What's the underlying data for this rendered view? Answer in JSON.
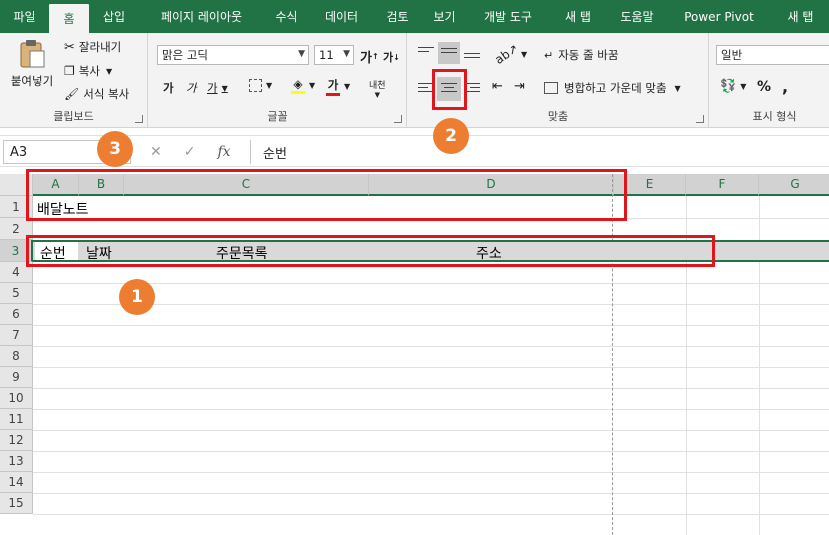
{
  "tabs": [
    {
      "label": "파일",
      "active": false
    },
    {
      "label": "홈",
      "active": true
    },
    {
      "label": "삽입",
      "active": false
    },
    {
      "label": "페이지 레이아웃",
      "active": false
    },
    {
      "label": "수식",
      "active": false
    },
    {
      "label": "데이터",
      "active": false
    },
    {
      "label": "검토",
      "active": false
    },
    {
      "label": "보기",
      "active": false
    },
    {
      "label": "개발 도구",
      "active": false
    },
    {
      "label": "새 탭",
      "active": false
    },
    {
      "label": "도움말",
      "active": false
    },
    {
      "label": "Power Pivot",
      "active": false
    },
    {
      "label": "새 탭",
      "active": false
    }
  ],
  "ribbon": {
    "clipboard": {
      "label": "클립보드",
      "paste_label": "붙여넣기",
      "cut_label": "잘라내기",
      "copy_label": "복사",
      "format_painter_label": "서식 복사"
    },
    "font": {
      "label": "글꼴",
      "font_name": "맑은 고딕",
      "font_size": "11",
      "grow_glyph": "가",
      "shrink_glyph": "가",
      "bold_glyph": "가",
      "italic_glyph": "가",
      "underline_glyph": "가",
      "font_color_glyph": "가",
      "phonetic_glyph": "내천"
    },
    "alignment": {
      "label": "맞춤",
      "wrap_text_label": "자동 줄 바꿈",
      "merge_center_label": "병합하고 가운데 맞춤"
    },
    "number": {
      "label": "표시 형식",
      "format_value": "일반",
      "percent_glyph": "%",
      "comma_glyph": ","
    }
  },
  "formula_bar": {
    "name_box": "A3",
    "cancel_glyph": "✕",
    "enter_glyph": "✓",
    "fx_glyph": "fx",
    "formula_value": "순번"
  },
  "sheet": {
    "columns": [
      "A",
      "B",
      "C",
      "D",
      "E",
      "F",
      "G"
    ],
    "rows": [
      "1",
      "2",
      "3",
      "4",
      "5",
      "6",
      "7",
      "8",
      "9",
      "10",
      "11",
      "12",
      "13",
      "14",
      "15"
    ],
    "selected_row": "3",
    "cells": {
      "A1": "배달노트",
      "A3": "순번",
      "B3": "날짜",
      "C3": "주문목록",
      "D3": "주소"
    }
  },
  "annotations": {
    "badge1": "1",
    "badge2": "2",
    "badge3": "3",
    "accent": "#e0161c",
    "badge_color": "#ed7d31"
  },
  "colors": {
    "excel_green": "#217346",
    "ribbon_bg": "#f3f3f3",
    "selection_fill": "#d9d9d9"
  }
}
